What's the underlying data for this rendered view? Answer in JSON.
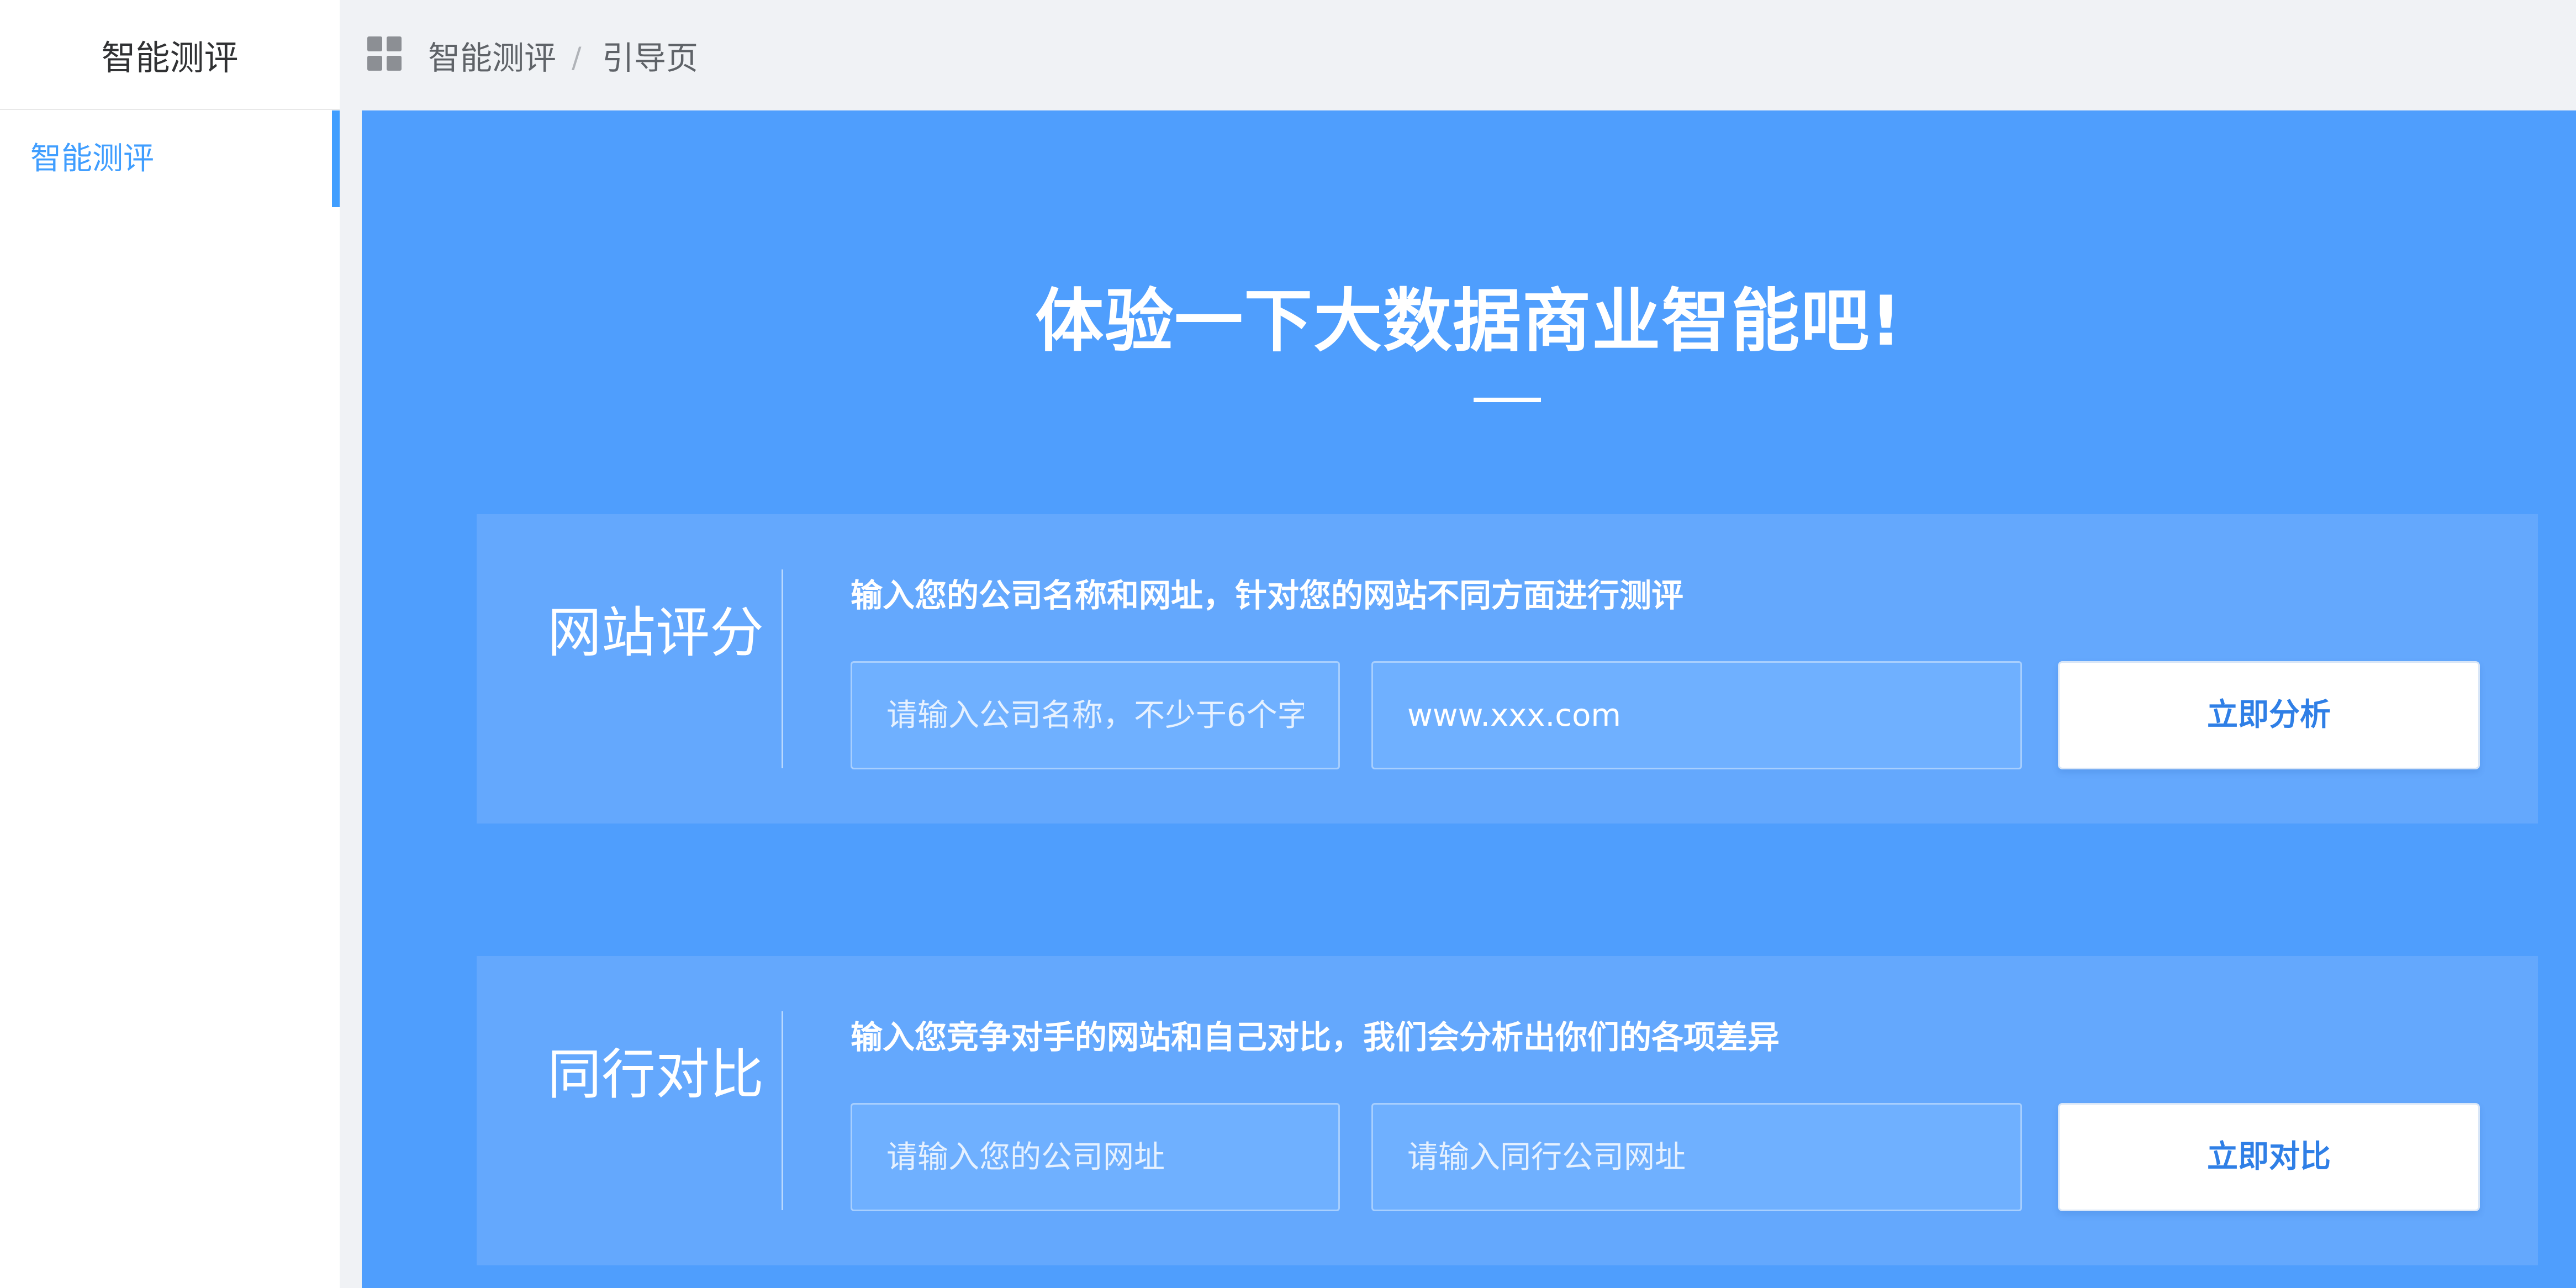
{
  "sidebar": {
    "title": "智能测评",
    "items": [
      {
        "label": "智能测评",
        "active": true
      }
    ]
  },
  "header": {
    "breadcrumb": [
      "智能测评",
      "引导页"
    ],
    "separator": "/"
  },
  "hero": {
    "title": "体验一下大数据商业智能吧!"
  },
  "website_score": {
    "title": "网站评分",
    "description": "输入您的公司名称和网址，针对您的网站不同方面进行测评",
    "company_name_placeholder": "请输入公司名称，不少于6个字",
    "company_name_value": "",
    "url_value": "www.xxx.com",
    "button_label": "立即分析"
  },
  "peer_compare": {
    "title": "同行对比",
    "description": "输入您竞争对手的网站和自己对比，我们会分析出你们的各项差异",
    "own_url_placeholder": "请输入您的公司网址",
    "peer_url_placeholder": "请输入同行公司网址",
    "button_label": "立即对比"
  },
  "colors": {
    "primary": "#409eff",
    "main_background": "#4f9efd",
    "card_background": "#64a8fd",
    "button_text": "#2f7fe6"
  },
  "icons": {
    "breadcrumb_icon": "grid-icon"
  }
}
